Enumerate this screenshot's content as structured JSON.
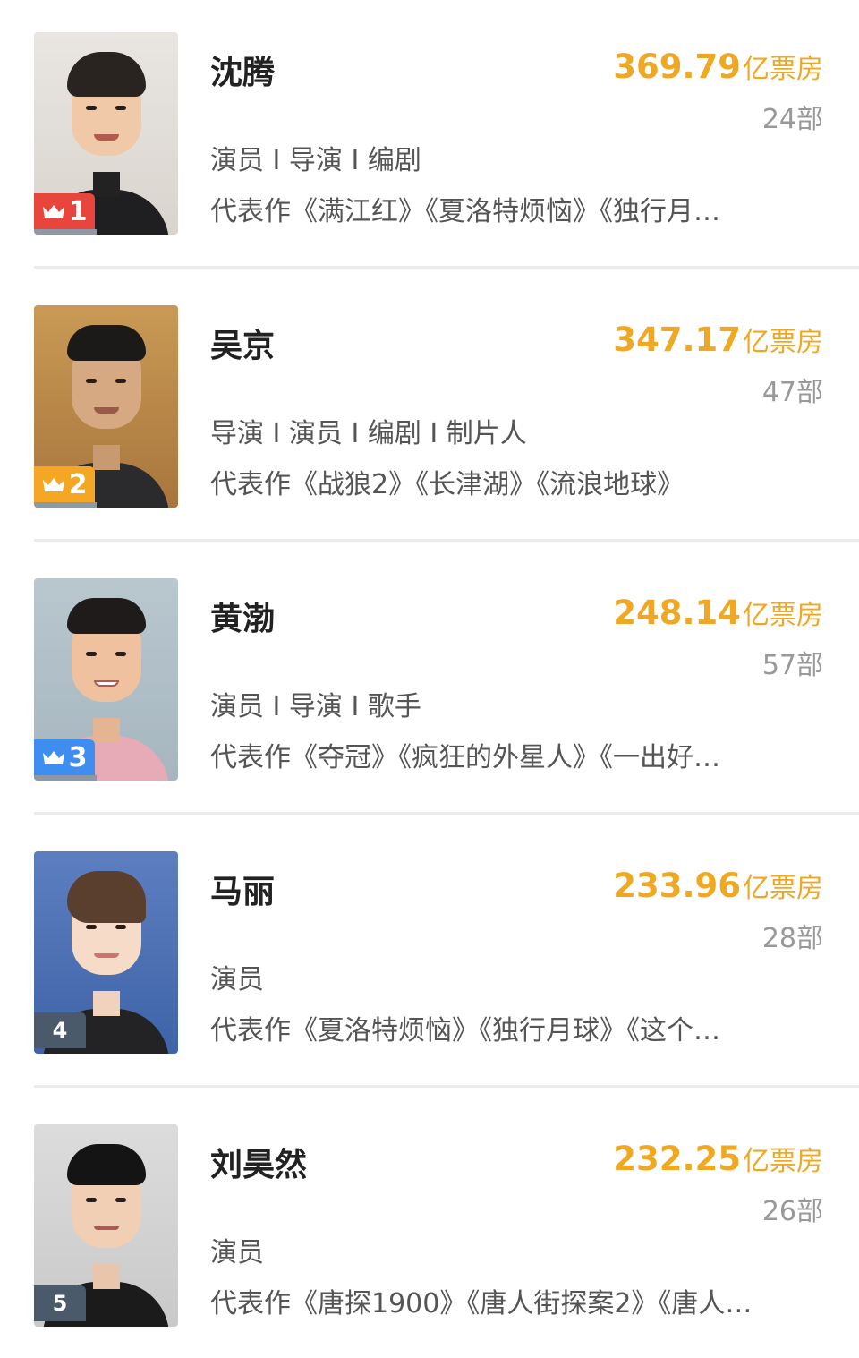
{
  "ranking": [
    {
      "rank": "1",
      "name": "沈腾",
      "box_office": "369.79",
      "box_office_unit": "亿票房",
      "film_count": "24部",
      "roles": "演员 I 导演 I 编剧",
      "works": "代表作《满江红》《夏洛特烦恼》《独行月…",
      "badge_color": "#e8453c",
      "crown": true
    },
    {
      "rank": "2",
      "name": "吴京",
      "box_office": "347.17",
      "box_office_unit": "亿票房",
      "film_count": "47部",
      "roles": "导演 I 演员 I 编剧 I 制片人",
      "works": "代表作《战狼2》《长津湖》《流浪地球》",
      "badge_color": "#f5a623",
      "crown": true
    },
    {
      "rank": "3",
      "name": "黄渤",
      "box_office": "248.14",
      "box_office_unit": "亿票房",
      "film_count": "57部",
      "roles": "演员 I 导演 I 歌手",
      "works": "代表作《夺冠》《疯狂的外星人》《一出好…",
      "badge_color": "#3d8ef0",
      "crown": true
    },
    {
      "rank": "4",
      "name": "马丽",
      "box_office": "233.96",
      "box_office_unit": "亿票房",
      "film_count": "28部",
      "roles": "演员",
      "works": "代表作《夏洛特烦恼》《独行月球》《这个…",
      "badge_color": "#4b5a6b",
      "crown": false
    },
    {
      "rank": "5",
      "name": "刘昊然",
      "box_office": "232.25",
      "box_office_unit": "亿票房",
      "film_count": "26部",
      "roles": "演员",
      "works": "代表作《唐探1900》《唐人街探案2》《唐人…",
      "badge_color": "#4b5a6b",
      "crown": false
    }
  ],
  "icons": {
    "crown": "crown-icon"
  },
  "colors": {
    "box_office": "#efa823",
    "text": "#555555",
    "count": "#999999"
  }
}
